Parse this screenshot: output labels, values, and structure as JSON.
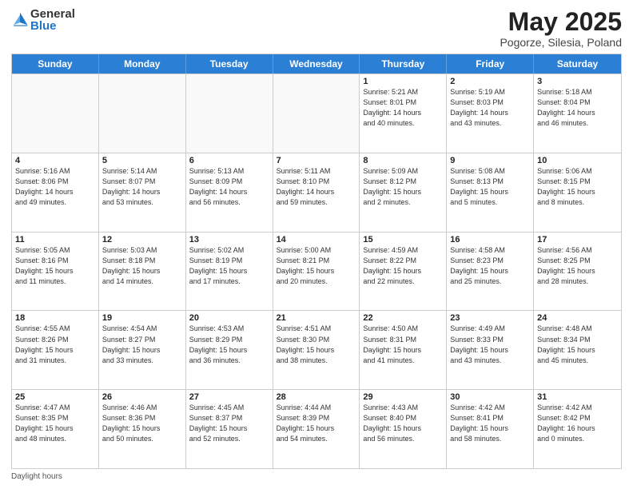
{
  "header": {
    "logo_general": "General",
    "logo_blue": "Blue",
    "title": "May 2025",
    "location": "Pogorze, Silesia, Poland"
  },
  "weekdays": [
    "Sunday",
    "Monday",
    "Tuesday",
    "Wednesday",
    "Thursday",
    "Friday",
    "Saturday"
  ],
  "footer": {
    "note": "Daylight hours"
  },
  "weeks": [
    [
      {
        "day": "",
        "info": "",
        "empty": true
      },
      {
        "day": "",
        "info": "",
        "empty": true
      },
      {
        "day": "",
        "info": "",
        "empty": true
      },
      {
        "day": "",
        "info": "",
        "empty": true
      },
      {
        "day": "1",
        "info": "Sunrise: 5:21 AM\nSunset: 8:01 PM\nDaylight: 14 hours\nand 40 minutes.",
        "empty": false
      },
      {
        "day": "2",
        "info": "Sunrise: 5:19 AM\nSunset: 8:03 PM\nDaylight: 14 hours\nand 43 minutes.",
        "empty": false
      },
      {
        "day": "3",
        "info": "Sunrise: 5:18 AM\nSunset: 8:04 PM\nDaylight: 14 hours\nand 46 minutes.",
        "empty": false
      }
    ],
    [
      {
        "day": "4",
        "info": "Sunrise: 5:16 AM\nSunset: 8:06 PM\nDaylight: 14 hours\nand 49 minutes.",
        "empty": false
      },
      {
        "day": "5",
        "info": "Sunrise: 5:14 AM\nSunset: 8:07 PM\nDaylight: 14 hours\nand 53 minutes.",
        "empty": false
      },
      {
        "day": "6",
        "info": "Sunrise: 5:13 AM\nSunset: 8:09 PM\nDaylight: 14 hours\nand 56 minutes.",
        "empty": false
      },
      {
        "day": "7",
        "info": "Sunrise: 5:11 AM\nSunset: 8:10 PM\nDaylight: 14 hours\nand 59 minutes.",
        "empty": false
      },
      {
        "day": "8",
        "info": "Sunrise: 5:09 AM\nSunset: 8:12 PM\nDaylight: 15 hours\nand 2 minutes.",
        "empty": false
      },
      {
        "day": "9",
        "info": "Sunrise: 5:08 AM\nSunset: 8:13 PM\nDaylight: 15 hours\nand 5 minutes.",
        "empty": false
      },
      {
        "day": "10",
        "info": "Sunrise: 5:06 AM\nSunset: 8:15 PM\nDaylight: 15 hours\nand 8 minutes.",
        "empty": false
      }
    ],
    [
      {
        "day": "11",
        "info": "Sunrise: 5:05 AM\nSunset: 8:16 PM\nDaylight: 15 hours\nand 11 minutes.",
        "empty": false
      },
      {
        "day": "12",
        "info": "Sunrise: 5:03 AM\nSunset: 8:18 PM\nDaylight: 15 hours\nand 14 minutes.",
        "empty": false
      },
      {
        "day": "13",
        "info": "Sunrise: 5:02 AM\nSunset: 8:19 PM\nDaylight: 15 hours\nand 17 minutes.",
        "empty": false
      },
      {
        "day": "14",
        "info": "Sunrise: 5:00 AM\nSunset: 8:21 PM\nDaylight: 15 hours\nand 20 minutes.",
        "empty": false
      },
      {
        "day": "15",
        "info": "Sunrise: 4:59 AM\nSunset: 8:22 PM\nDaylight: 15 hours\nand 22 minutes.",
        "empty": false
      },
      {
        "day": "16",
        "info": "Sunrise: 4:58 AM\nSunset: 8:23 PM\nDaylight: 15 hours\nand 25 minutes.",
        "empty": false
      },
      {
        "day": "17",
        "info": "Sunrise: 4:56 AM\nSunset: 8:25 PM\nDaylight: 15 hours\nand 28 minutes.",
        "empty": false
      }
    ],
    [
      {
        "day": "18",
        "info": "Sunrise: 4:55 AM\nSunset: 8:26 PM\nDaylight: 15 hours\nand 31 minutes.",
        "empty": false
      },
      {
        "day": "19",
        "info": "Sunrise: 4:54 AM\nSunset: 8:27 PM\nDaylight: 15 hours\nand 33 minutes.",
        "empty": false
      },
      {
        "day": "20",
        "info": "Sunrise: 4:53 AM\nSunset: 8:29 PM\nDaylight: 15 hours\nand 36 minutes.",
        "empty": false
      },
      {
        "day": "21",
        "info": "Sunrise: 4:51 AM\nSunset: 8:30 PM\nDaylight: 15 hours\nand 38 minutes.",
        "empty": false
      },
      {
        "day": "22",
        "info": "Sunrise: 4:50 AM\nSunset: 8:31 PM\nDaylight: 15 hours\nand 41 minutes.",
        "empty": false
      },
      {
        "day": "23",
        "info": "Sunrise: 4:49 AM\nSunset: 8:33 PM\nDaylight: 15 hours\nand 43 minutes.",
        "empty": false
      },
      {
        "day": "24",
        "info": "Sunrise: 4:48 AM\nSunset: 8:34 PM\nDaylight: 15 hours\nand 45 minutes.",
        "empty": false
      }
    ],
    [
      {
        "day": "25",
        "info": "Sunrise: 4:47 AM\nSunset: 8:35 PM\nDaylight: 15 hours\nand 48 minutes.",
        "empty": false
      },
      {
        "day": "26",
        "info": "Sunrise: 4:46 AM\nSunset: 8:36 PM\nDaylight: 15 hours\nand 50 minutes.",
        "empty": false
      },
      {
        "day": "27",
        "info": "Sunrise: 4:45 AM\nSunset: 8:37 PM\nDaylight: 15 hours\nand 52 minutes.",
        "empty": false
      },
      {
        "day": "28",
        "info": "Sunrise: 4:44 AM\nSunset: 8:39 PM\nDaylight: 15 hours\nand 54 minutes.",
        "empty": false
      },
      {
        "day": "29",
        "info": "Sunrise: 4:43 AM\nSunset: 8:40 PM\nDaylight: 15 hours\nand 56 minutes.",
        "empty": false
      },
      {
        "day": "30",
        "info": "Sunrise: 4:42 AM\nSunset: 8:41 PM\nDaylight: 15 hours\nand 58 minutes.",
        "empty": false
      },
      {
        "day": "31",
        "info": "Sunrise: 4:42 AM\nSunset: 8:42 PM\nDaylight: 16 hours\nand 0 minutes.",
        "empty": false
      }
    ]
  ]
}
